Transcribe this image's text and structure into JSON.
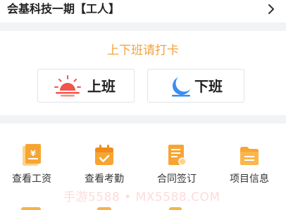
{
  "header": {
    "project_title": "会基科技一期【工人】",
    "chevron_icon": "chevron-right-icon"
  },
  "punch": {
    "prompt": "上下班请打卡",
    "prompt_color": "#f3a23c",
    "clock_in_label": "上班",
    "clock_in_icon": "sunrise-icon",
    "clock_out_label": "下班",
    "clock_out_icon": "moon-icon"
  },
  "grid": {
    "items": [
      {
        "label": "查看工资",
        "icon": "salary-icon"
      },
      {
        "label": "查看考勤",
        "icon": "attendance-calendar-icon"
      },
      {
        "label": "合同签订",
        "icon": "contract-icon"
      },
      {
        "label": "项目信息",
        "icon": "project-folder-icon"
      }
    ]
  },
  "watermark": "手游5588 • MX5588.COM"
}
